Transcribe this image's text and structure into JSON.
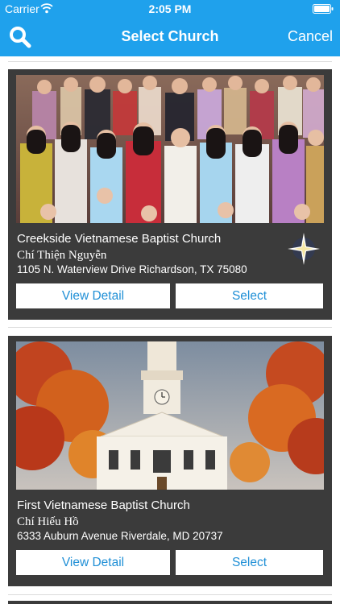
{
  "status_bar": {
    "carrier": "Carrier",
    "time": "2:05 PM"
  },
  "nav": {
    "title": "Select Church",
    "cancel_label": "Cancel",
    "search_icon": "search-icon"
  },
  "colors": {
    "nav_background": "#1fa1ec",
    "card_background": "#3b3b3b",
    "button_text": "#1f8fd6"
  },
  "churches": [
    {
      "name": "Creekside Vietnamese Baptist Church",
      "pastor": "Chí Thiện Nguyễn",
      "address": "1105 N. Waterview Drive Richardson, TX 75080",
      "detail_label": "View Detail",
      "select_label": "Select",
      "has_logo": true
    },
    {
      "name": "First Vietnamese Baptist Church",
      "pastor": "Chí Hiếu Hồ",
      "address": "6333 Auburn Avenue Riverdale, MD 20737",
      "detail_label": "View Detail",
      "select_label": "Select",
      "has_logo": false
    }
  ]
}
